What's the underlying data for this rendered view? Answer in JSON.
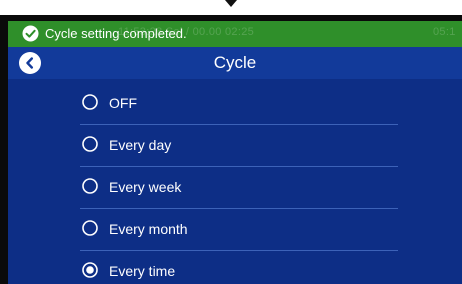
{
  "toast": {
    "message": "Cycle setting completed."
  },
  "status_bar": {
    "ghost_left": "11:53:28 Sel / 00.00 02:25",
    "ghost_right": "05:1"
  },
  "header": {
    "title": "Cycle"
  },
  "options": [
    {
      "label": "OFF",
      "selected": false
    },
    {
      "label": "Every day",
      "selected": false
    },
    {
      "label": "Every week",
      "selected": false
    },
    {
      "label": "Every month",
      "selected": false
    },
    {
      "label": "Every time",
      "selected": true
    }
  ],
  "icons": {
    "toast": "check-circle-icon",
    "back": "chevron-left-icon",
    "radio_off": "radio-unchecked-icon",
    "radio_on": "radio-checked-icon"
  },
  "colors": {
    "status_bar": "#2f8f2a",
    "screen_bg": "#0d2e86",
    "header_bg": "#123a9a",
    "divider": "#3c62b8",
    "text": "#ffffff"
  }
}
